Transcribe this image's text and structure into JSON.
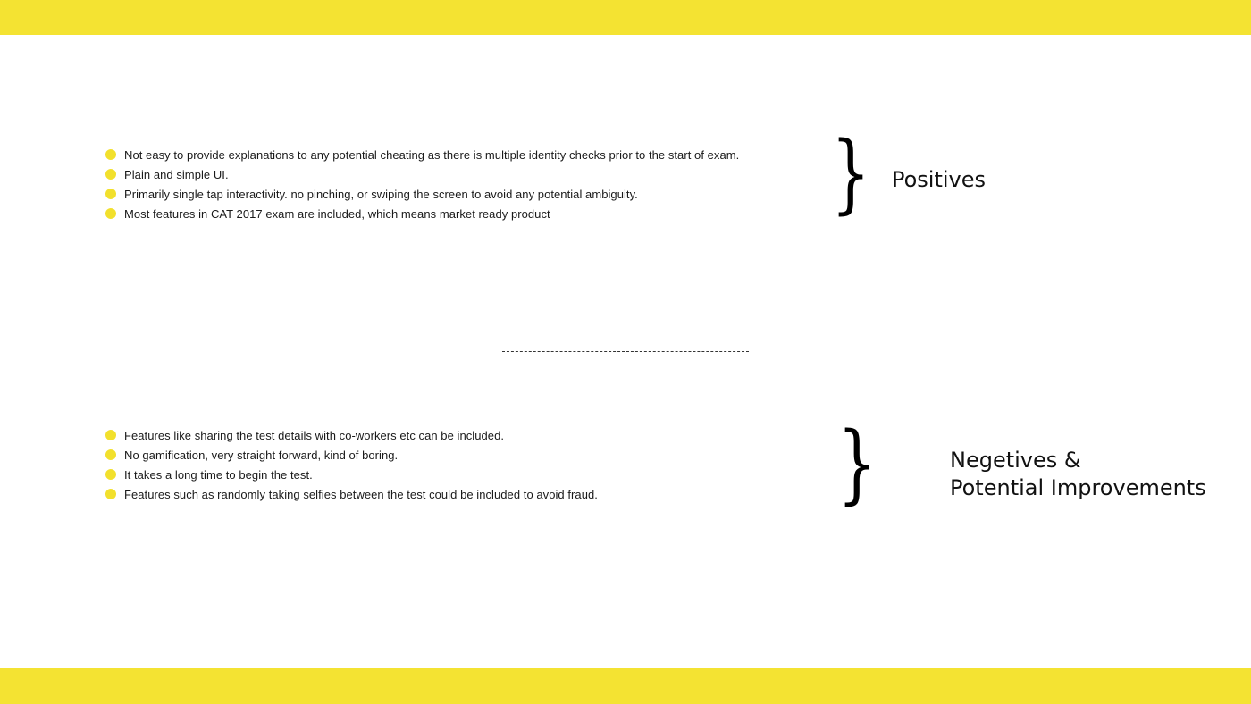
{
  "theme": {
    "band_color": "#f4e332",
    "bullet_color": "#f2e02c",
    "text_color": "#1a1a1a"
  },
  "positives": {
    "heading": "Positives",
    "brace_icon": "right-curly-brace",
    "brace_glyph": "}",
    "items": [
      "Not easy to provide explanations to any potential cheating as there is multiple identity checks prior to the start of exam.",
      "Plain and simple UI.",
      "Primarily single tap interactivity. no pinching, or swiping the screen to avoid any potential ambiguity.",
      "Most features in CAT 2017 exam are included, which means market ready product"
    ]
  },
  "divider": {
    "style": "dashed"
  },
  "negatives": {
    "heading_line1": "Negetives &",
    "heading_line2": "Potential Improvements",
    "brace_icon": "right-curly-brace",
    "brace_glyph": "}",
    "items": [
      "Features like sharing the test details with co-workers etc can be included.",
      "No gamification, very straight forward, kind of boring.",
      "It takes a long time to begin the test.",
      "Features such as randomly taking selfies between the test could be included to avoid fraud."
    ]
  }
}
